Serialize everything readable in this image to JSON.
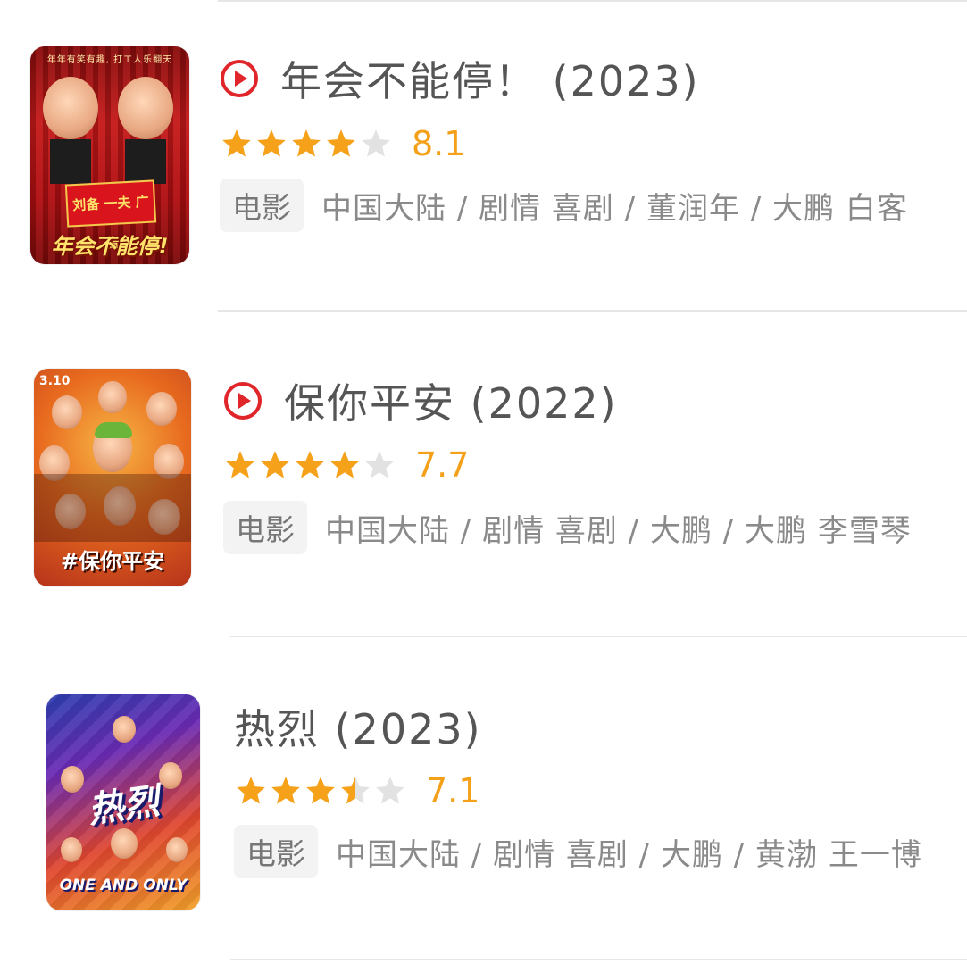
{
  "movies": [
    {
      "title": "年会不能停！ (2023)",
      "score": "8.1",
      "rating": 4.0,
      "type": "电影",
      "meta": "中国大陆 / 剧情 喜剧 / 董润年 / 大鹏 白客",
      "playable": true,
      "poster": {
        "tagline": "年年有笑有趣, 打工人乐翻天",
        "sign": "刘备 一夫 广告",
        "title": "年会不能停!"
      }
    },
    {
      "title": "保你平安 (2022)",
      "score": "7.7",
      "rating": 4.0,
      "type": "电影",
      "meta": "中国大陆 / 剧情 喜剧 / 大鹏 / 大鹏 李雪琴",
      "playable": true,
      "poster": {
        "date": "3.10",
        "title": "#保你平安"
      }
    },
    {
      "title": "热烈 (2023)",
      "score": "7.1",
      "rating": 3.5,
      "type": "电影",
      "meta": "中国大陆 / 剧情 喜剧 / 大鹏 / 黄渤 王一博",
      "playable": false,
      "poster": {
        "title": "热烈",
        "subtitle": "ONE AND ONLY"
      }
    }
  ],
  "colors": {
    "accent": "#e0262a",
    "star": "#f6a11a",
    "star_empty": "#e2e2e2",
    "text": "#555555",
    "meta": "#8a8a8a"
  },
  "icons": {
    "play": "play-circle-icon",
    "star": "star-icon"
  }
}
